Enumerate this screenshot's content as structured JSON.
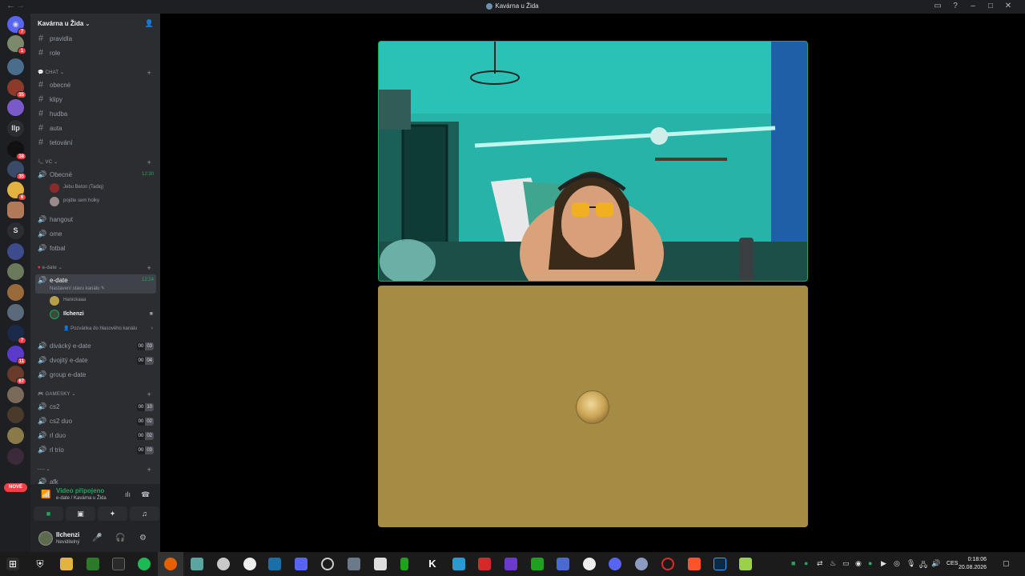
{
  "window": {
    "title": "Kavárna u Žida"
  },
  "server": {
    "name": "Kavárna u Žida"
  },
  "guild_badges": [
    "7",
    "1",
    "35",
    "38",
    "35",
    "6",
    "7",
    "11",
    "67"
  ],
  "guild_text": {
    "ilp": "Ilp",
    "s": "S"
  },
  "new_badge": "NOVÉ",
  "channels": {
    "pravidla": "pravidla",
    "role": "role",
    "cat_chat": "CHAT",
    "obecne": "obecné",
    "klipy": "klipy",
    "hudba": "hudba",
    "auta": "auta",
    "tetovani": "tetování",
    "cat_vc": "VC",
    "vc_obecne": "Obecné",
    "vc_obecne_time": "12:30",
    "vc_user1": "Jebu Beton (Tadiq)",
    "vc_user2": "pojdte sem holky",
    "hangout": "hangout",
    "ome": "ome",
    "fotbal": "fotbal",
    "cat_edate": "e-date",
    "edate": "e-date",
    "edate_time": "12:24",
    "edate_status": "Nastavení stavu kanálu",
    "edate_user1": "Hanickaaa",
    "edate_user2": "Ilchenzi",
    "edate_invite": "Pozvánka do hlasového kanálu",
    "divacky": "divácký e-date",
    "divacky_counts": [
      "00",
      "03"
    ],
    "dvojity": "dvojitý e-date",
    "dvojity_counts": [
      "00",
      "04"
    ],
    "group": "group e-date",
    "cat_gamesky": "GAMESKY",
    "cs2": "cs2",
    "cs2_counts": [
      "00",
      "10"
    ],
    "cs2duo": "cs2 duo",
    "cs2duo_counts": [
      "00",
      "02"
    ],
    "rlduo": "rl duo",
    "rlduo_counts": [
      "00",
      "02"
    ],
    "rltrio": "rl trio",
    "rltrio_counts": [
      "00",
      "03"
    ],
    "cat_misc": "----",
    "afk": "afk"
  },
  "voice_panel": {
    "status": "Video připojeno",
    "location": "e-date / Kavárna u Žida"
  },
  "user": {
    "name": "Ilchenzi",
    "status": "Neviditelný"
  },
  "taskbar": {
    "lang": "CES",
    "time": "0:18:06",
    "date": "20.08.2026"
  },
  "colors": {
    "accent_green": "#23a559",
    "sidebar": "#2b2d31",
    "guild_bar": "#1e1f22",
    "tile_avatar_bg": "#a58b43"
  }
}
